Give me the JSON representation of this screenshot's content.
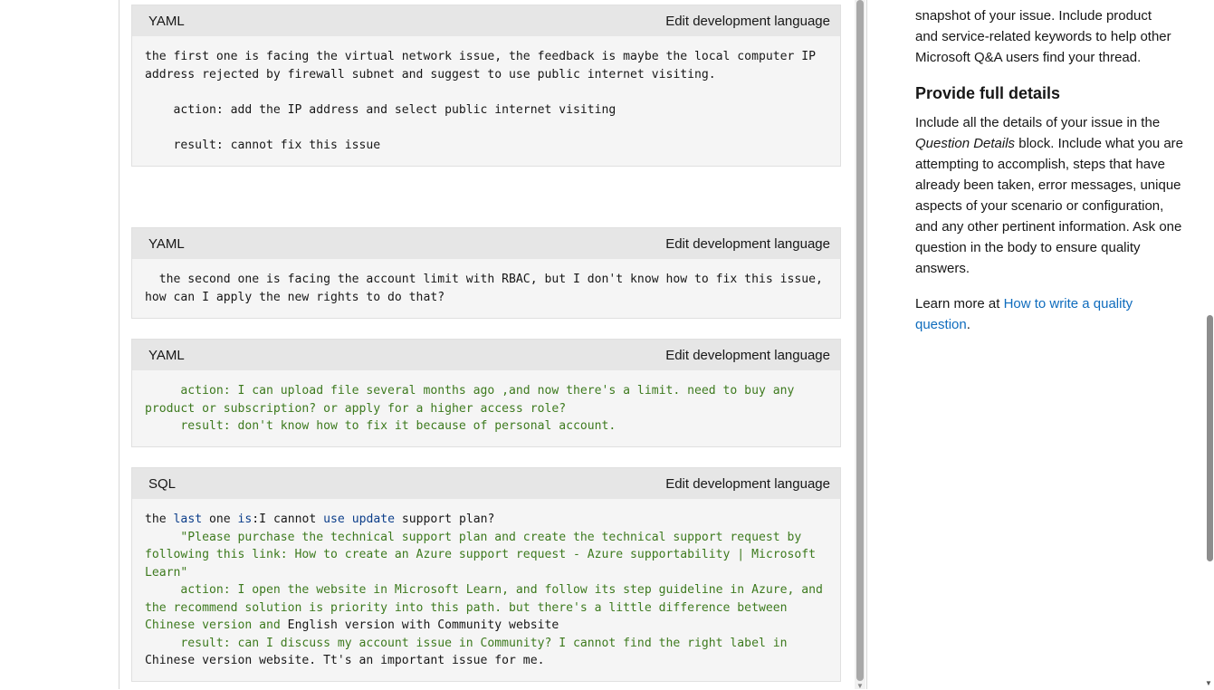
{
  "blocks": [
    {
      "lang": "YAML",
      "edit_label": "Edit development language",
      "lines": [
        "the first one is facing the virtual network issue, the feedback is maybe the local computer IP",
        "address rejected by firewall subnet and suggest to use public internet visiting.",
        "",
        "    action: add the IP address and select public internet visiting",
        "",
        "    result: cannot fix this issue"
      ]
    },
    {
      "lang": "YAML",
      "edit_label": "Edit development language",
      "lines": [
        "  the second one is facing the account limit with RBAC, but I don't know how to fix this issue,",
        "how can I apply the new rights to do that?"
      ]
    },
    {
      "lang": "YAML",
      "edit_label": "Edit development language",
      "lines": [
        "     action: I can upload file several months ago ,and now there's a limit. need to buy any",
        "product or subscription? or apply for a higher access role?",
        "     result: don't know how to fix it because of personal account."
      ]
    },
    {
      "lang": "SQL",
      "edit_label": "Edit development language",
      "line1": {
        "a": "the ",
        "b": "last",
        "c": " one ",
        "d": "is",
        "e": ":I cannot ",
        "f": "use",
        "g": " ",
        "h": "update",
        "i": " support plan?"
      },
      "lines": [
        "     \"Please purchase the technical support plan and create the technical support request by",
        "following this link: How to create an Azure support request - Azure supportability | Microsoft",
        "Learn\"",
        "     action: I open the website in Microsoft Learn, and follow its step guideline in Azure, and",
        "the recommend solution is priority into this path. but there's a little difference between"
      ],
      "line8": {
        "a": "Chinese version ",
        "b": "and",
        "c": " English version with Community website"
      },
      "line9": "     result: can I discuss my account issue in Community? I cannot find the right label in",
      "line10": "Chinese version website. Tt's an important issue for me."
    }
  ],
  "sidebar": {
    "intro_lines": [
      "snapshot of your issue. Include product",
      "and service-related keywords to help other",
      "Microsoft Q&A users find your thread."
    ],
    "heading": "Provide full details",
    "details_a": "Include all the details of your issue in the",
    "details_em": "Question Details",
    "details_b": " block. Include what you are attempting to accomplish, steps that have already been taken, error messages, unique aspects of your scenario or configuration, and any other pertinent information. Ask one question in the body to ensure quality answers.",
    "learn_prefix": "Learn more at ",
    "learn_link": "How to write a quality question",
    "learn_suffix": "."
  },
  "colors": {
    "string": "#3d7a1e",
    "keyword": "#0c3e8a",
    "link": "#0f6cbd"
  }
}
